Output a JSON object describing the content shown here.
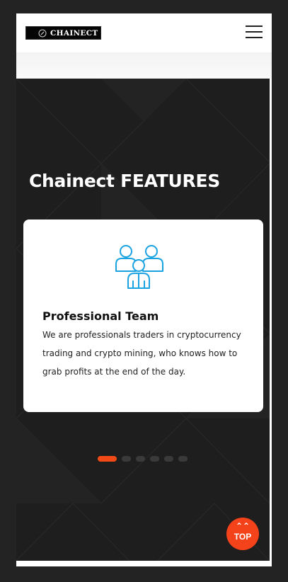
{
  "brand": {
    "name": "CHAINECT"
  },
  "header": {
    "menu_icon": "hamburger-menu-icon"
  },
  "features": {
    "title": "Chainect FEATURES",
    "card": {
      "icon": "team-icon",
      "title": "Professional Team",
      "text": "We are professionals traders in cryptocurrency trading and crypto mining, who knows how to grab profits at the end of the day."
    },
    "pagination": {
      "total": 6,
      "active": 1
    }
  },
  "back_to_top": {
    "arrow": "⌃⌃",
    "label": "TOP"
  },
  "colors": {
    "accent": "#f24a16",
    "dark_bg": "#1e1e1e",
    "icon_blue": "#1aa3e0"
  }
}
